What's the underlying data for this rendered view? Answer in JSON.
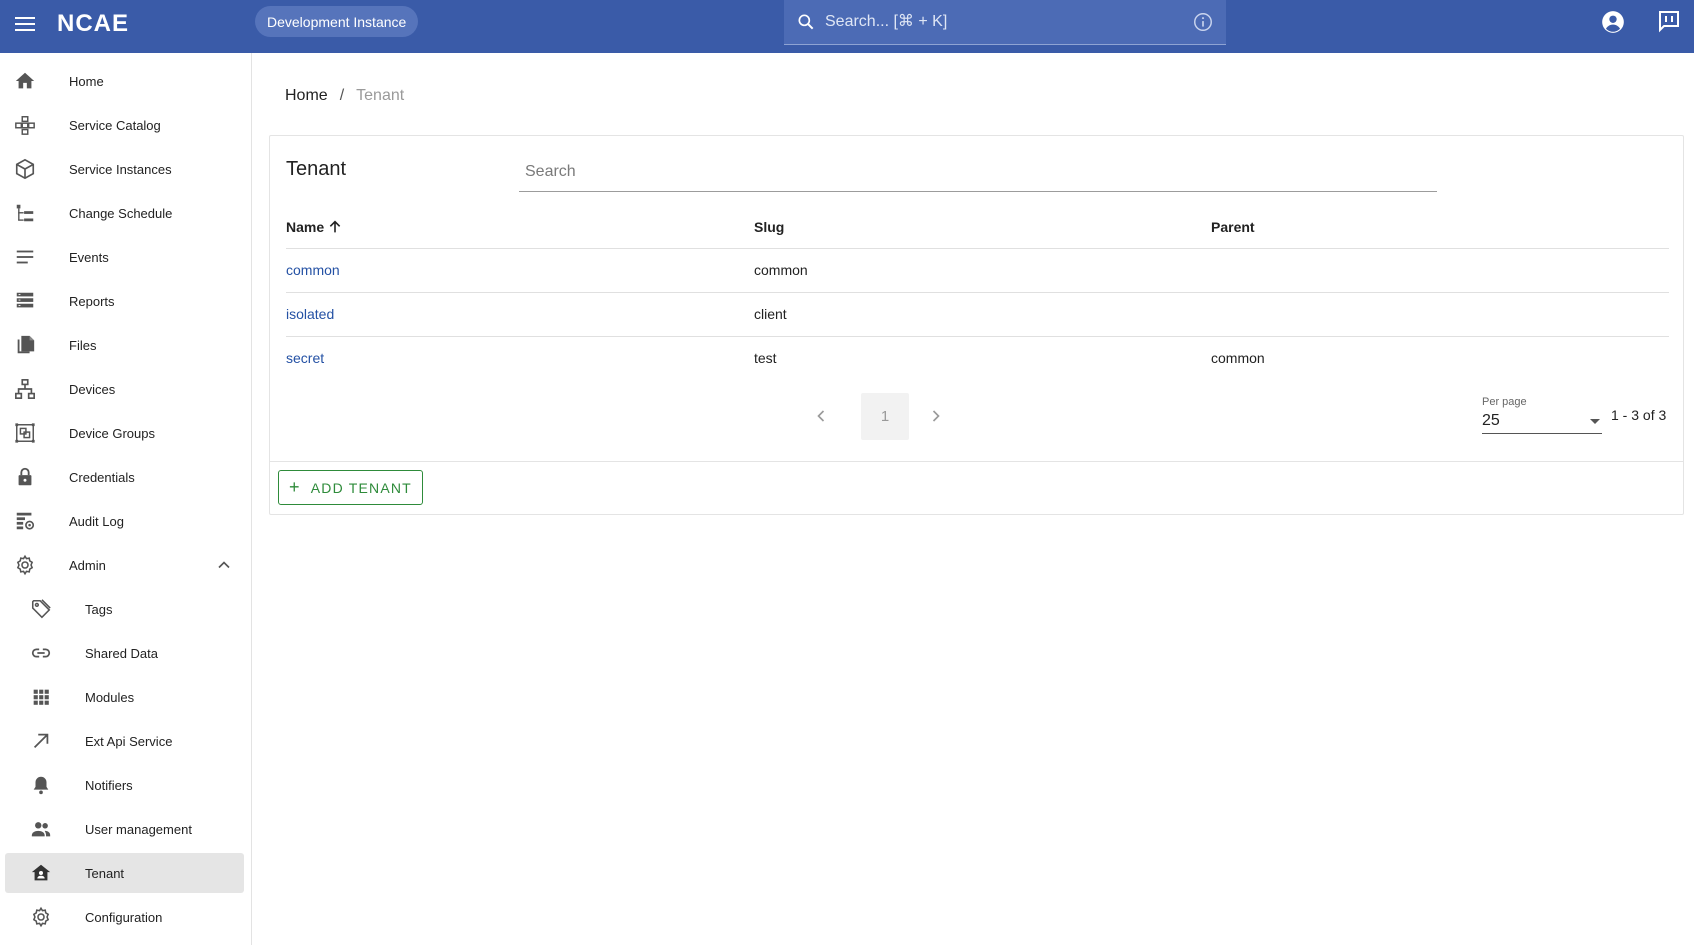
{
  "header": {
    "logo_text": "NCAE",
    "instance_badge": "Development Instance",
    "search_placeholder": "Search... [⌘ + K]"
  },
  "sidebar": {
    "items": [
      {
        "label": "Home",
        "icon": "home-icon"
      },
      {
        "label": "Service Catalog",
        "icon": "service-catalog-icon"
      },
      {
        "label": "Service Instances",
        "icon": "cube-icon"
      },
      {
        "label": "Change Schedule",
        "icon": "tree-icon"
      },
      {
        "label": "Events",
        "icon": "lines-icon"
      },
      {
        "label": "Reports",
        "icon": "reports-icon"
      },
      {
        "label": "Files",
        "icon": "files-icon"
      },
      {
        "label": "Devices",
        "icon": "network-icon"
      },
      {
        "label": "Device Groups",
        "icon": "device-groups-icon"
      },
      {
        "label": "Credentials",
        "icon": "lock-icon"
      },
      {
        "label": "Audit Log",
        "icon": "audit-log-icon"
      },
      {
        "label": "Admin",
        "icon": "gear-icon"
      }
    ],
    "admin_items": [
      {
        "label": "Tags",
        "icon": "tag-icon"
      },
      {
        "label": "Shared Data",
        "icon": "link-icon"
      },
      {
        "label": "Modules",
        "icon": "grid-icon"
      },
      {
        "label": "Ext Api Service",
        "icon": "arrow-up-right-icon"
      },
      {
        "label": "Notifiers",
        "icon": "bell-icon"
      },
      {
        "label": "User management",
        "icon": "users-icon"
      },
      {
        "label": "Tenant",
        "icon": "tenant-icon"
      },
      {
        "label": "Configuration",
        "icon": "gear-icon"
      }
    ],
    "active": "Tenant"
  },
  "breadcrumb": {
    "home": "Home",
    "separator": "/",
    "current": "Tenant"
  },
  "card": {
    "title": "Tenant",
    "search_placeholder": "Search",
    "columns": {
      "name": "Name",
      "slug": "Slug",
      "parent": "Parent"
    },
    "rows": [
      {
        "name": "common",
        "slug": "common",
        "parent": ""
      },
      {
        "name": "isolated",
        "slug": "client",
        "parent": ""
      },
      {
        "name": "secret",
        "slug": "test",
        "parent": "common"
      }
    ],
    "pagination": {
      "current_page": "1",
      "per_page_label": "Per page",
      "per_page_value": "25",
      "range": "1 - 3 of 3"
    },
    "add_button": "ADD TENANT"
  },
  "colors": {
    "topbar": "#3a5ba8",
    "link": "#2451a4",
    "add_button": "#2e8b3a",
    "active_nav": "#e5e5e5"
  }
}
